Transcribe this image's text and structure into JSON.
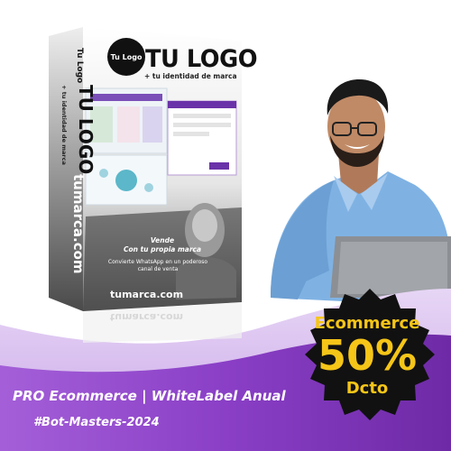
{
  "box": {
    "logo_circle_text": "Tu Logo",
    "logo_title": "TU LOGO",
    "logo_subtitle": "+ tu identidad de marca",
    "side_logo_small": "Tu Logo",
    "side_logo_title": "TU LOGO",
    "side_logo_subtitle": "+ tu identidad de marca",
    "side_domain": "tumarca.com",
    "vende_line1": "Vende",
    "vende_line2": "Con tu propia marca",
    "convierte_text": "Convierte WhatsApp en un poderoso canal de venta",
    "front_domain": "tumarca.com",
    "reflection_domain": "tumarca.com"
  },
  "badge": {
    "line1": "Ecommerce",
    "line2": "50%",
    "line3": "Dcto",
    "color": "#f5c518"
  },
  "footer": {
    "promo": "PRO Ecommerce | WhiteLabel Anual",
    "hashtag": "#Bot-Masters-2024"
  },
  "colors": {
    "purple": "#8a3fc6",
    "light_purple": "#c9a6e8",
    "shirt_blue": "#7fb2e3",
    "badge_black": "#111111"
  }
}
